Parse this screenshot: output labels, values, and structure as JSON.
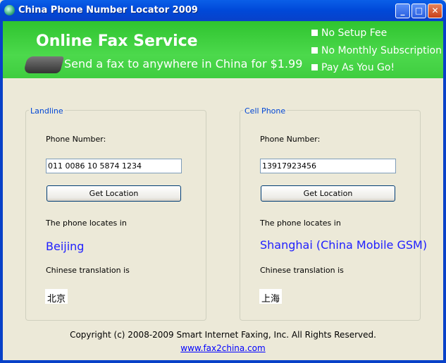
{
  "window": {
    "title": "China Phone Number Locator 2009"
  },
  "banner": {
    "headline": "Online Fax Service",
    "subline": "Send a fax to anywhere in China for $1.99",
    "bullets": [
      "No Setup Fee",
      "No Monthly Subscription",
      "Pay As You Go!"
    ]
  },
  "landline": {
    "legend": "Landline",
    "phone_label": "Phone Number:",
    "phone_value": "011 0086 10 5874 1234",
    "button": "Get Location",
    "locates_label": "The phone locates in",
    "location": "Beijing",
    "translation_label": "Chinese translation is",
    "translation": "北京"
  },
  "cell": {
    "legend": "Cell Phone",
    "phone_label": "Phone Number:",
    "phone_value": "13917923456",
    "button": "Get Location",
    "locates_label": "The phone locates in",
    "location": "Shanghai (China Mobile GSM)",
    "translation_label": "Chinese translation is",
    "translation": "上海"
  },
  "footer": {
    "copyright": "Copyright (c) 2008-2009 Smart Internet Faxing, Inc. All Rights Reserved.",
    "link": "www.fax2china.com"
  }
}
